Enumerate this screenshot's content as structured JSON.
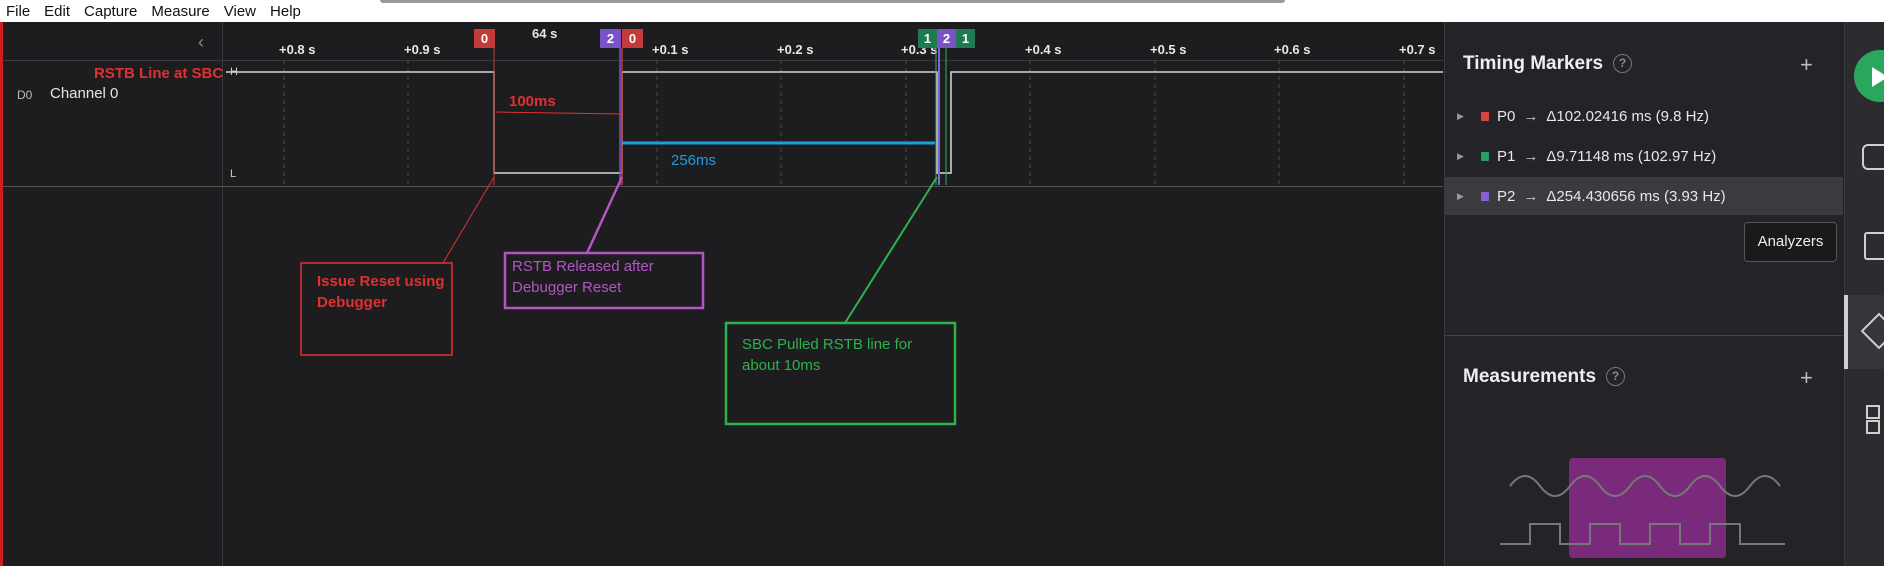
{
  "menu": [
    "File",
    "Edit",
    "Capture",
    "Measure",
    "View",
    "Help"
  ],
  "channel": {
    "id": "D0",
    "name": "Channel 0",
    "high_label": "H",
    "low_label": "L"
  },
  "ticks": [
    "+0.8 s",
    "+0.9 s",
    "+0.1 s",
    "+0.2 s",
    "+0.3 s",
    "+0.4 s",
    "+0.5 s",
    "+0.6 s",
    "+0.7 s"
  ],
  "top_time": "64 s",
  "markers": [
    {
      "label": "0",
      "color": "#c23a3a"
    },
    {
      "label": "2",
      "color": "#7a52c7"
    },
    {
      "label": "0",
      "color": "#c23a3a"
    },
    {
      "label": "1",
      "color": "#1e7a4f"
    },
    {
      "label": "2",
      "color": "#7a52c7"
    },
    {
      "label": "1",
      "color": "#1e7a4f"
    }
  ],
  "annotations": {
    "rstb_line": "RSTB Line at SBC",
    "ms100": "100ms",
    "ms256": "256ms",
    "issue_reset": [
      "Issue Reset using",
      "Debugger"
    ],
    "rstb_released": [
      "RSTB Released after",
      "Debugger Reset"
    ],
    "sbc_pulled": [
      "SBC Pulled RSTB line for",
      "about 10ms"
    ],
    "colors": {
      "red": "#e03030",
      "purple": "#b455c4",
      "green": "#2fb14a",
      "blue": "#1e9de0"
    }
  },
  "sidebar": {
    "timing_title": "Timing Markers",
    "help_glyph": "?",
    "add_glyph": "+",
    "timing_rows": [
      {
        "name": "P0",
        "delta": "Δ102.02416 ms (9.8 Hz)",
        "color": "#d94545"
      },
      {
        "name": "P1",
        "delta": "Δ9.71148 ms (102.97 Hz)",
        "color": "#27a06a"
      },
      {
        "name": "P2",
        "delta": "Δ254.430656 ms (3.93 Hz)",
        "color": "#8b5fd6"
      }
    ],
    "measure_title": "Measurements",
    "tooltip": "Analyzers"
  }
}
